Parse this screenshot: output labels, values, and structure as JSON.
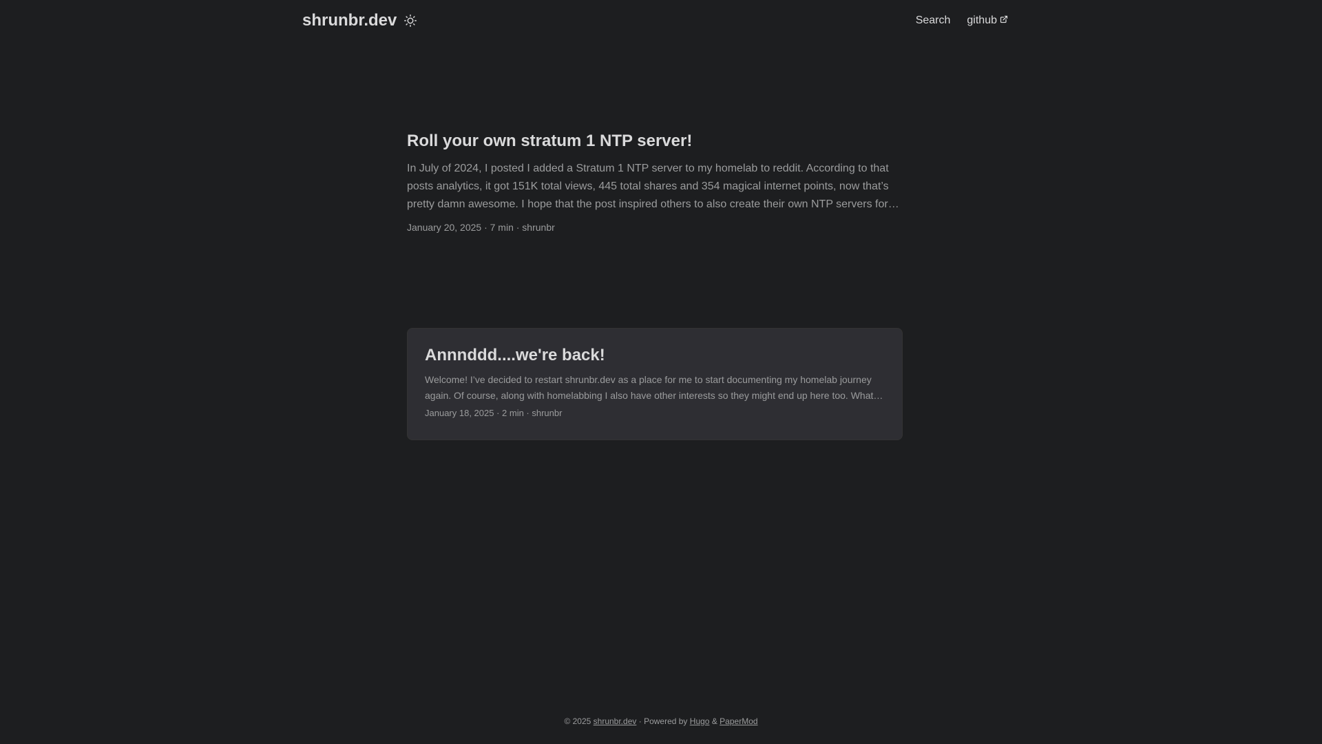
{
  "header": {
    "logo": "shrunbr.dev",
    "theme_icon": "sun-icon",
    "nav": [
      {
        "label": "Search"
      },
      {
        "label": "github",
        "icon": "external-link-icon"
      }
    ]
  },
  "posts": [
    {
      "title": "Roll your own stratum 1 NTP server!",
      "summary": "In July of 2024, I posted I added a Stratum 1 NTP server to my homelab to reddit. According to that posts analytics, it got 151K total views, 445 total shares and 354 magical internet points, now that’s pretty damn awesome. I hope that the post inspired others to also create their own NTP servers for their homelabs.",
      "meta": "January 20, 2025 · 7 min · shrunbr"
    },
    {
      "title": "Annnddd....we're back!",
      "summary": "Welcome! I’ve decided to restart shrunbr.dev as a place for me to start documenting my homelab journey again. Of course, along with homelabbing I also have other interests so they might end up here too. What else might you find here?",
      "meta": "January 18, 2025 · 2 min · shrunbr"
    }
  ],
  "footer": {
    "copyright": "© 2025",
    "site_link": "shrunbr.dev",
    "sep": "·",
    "powered_by": "Powered by",
    "hugo": "Hugo",
    "amp": "&",
    "papermod": "PaperMod"
  },
  "colors": {
    "background": "#1d1e20",
    "card": "#2e2e33",
    "primary_text": "#dadadb",
    "secondary_text": "#9b9c9d"
  }
}
